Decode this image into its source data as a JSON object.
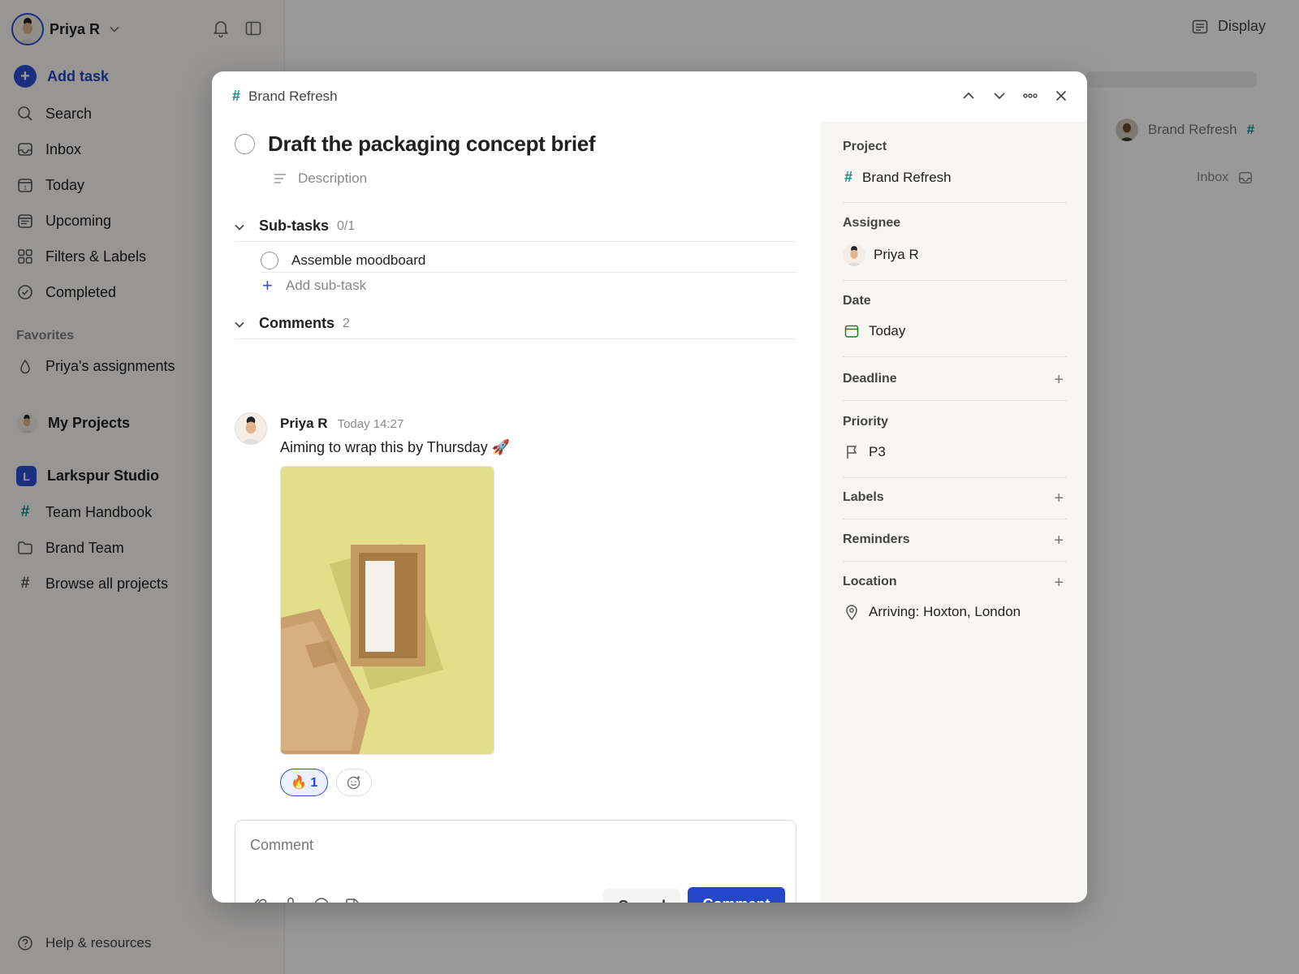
{
  "sidebar": {
    "user_name": "Priya R",
    "add_task": "Add task",
    "nav": [
      {
        "label": "Search",
        "icon": "search-icon"
      },
      {
        "label": "Inbox",
        "icon": "inbox-icon"
      },
      {
        "label": "Today",
        "icon": "calendar-today-icon"
      },
      {
        "label": "Upcoming",
        "icon": "calendar-upcoming-icon"
      },
      {
        "label": "Filters & Labels",
        "icon": "grid-icon"
      },
      {
        "label": "Completed",
        "icon": "check-circle-icon"
      }
    ],
    "favorites_title": "Favorites",
    "favorite_item": "Priya's assignments",
    "my_projects": "My Projects",
    "team": {
      "badge": "L",
      "name": "Larkspur Studio"
    },
    "team_items": [
      {
        "label": "Team Handbook",
        "icon": "hash-icon"
      },
      {
        "label": "Brand Team",
        "icon": "folder-icon"
      },
      {
        "label": "Browse all projects",
        "icon": "hash-icon"
      }
    ],
    "help": "Help & resources"
  },
  "background": {
    "display": "Display",
    "project": "Brand Refresh",
    "project_hash": "#",
    "inbox": "Inbox"
  },
  "modal": {
    "breadcrumb_hash": "#",
    "breadcrumb": "Brand Refresh",
    "title": "Draft the packaging concept brief",
    "description_placeholder": "Description",
    "subtasks": {
      "title": "Sub-tasks",
      "count": "0/1",
      "items": [
        "Assemble moodboard"
      ],
      "add_label": "Add sub-task"
    },
    "comments": {
      "title": "Comments",
      "count": "2"
    },
    "comment": {
      "author": "Priya R",
      "time": "Today 14:27",
      "text": "Aiming to wrap this by Thursday 🚀",
      "reaction": "🔥 1"
    },
    "composer": {
      "placeholder": "Comment",
      "cancel": "Cancel",
      "submit": "Comment"
    },
    "details": {
      "project_label": "Project",
      "project_hash": "#",
      "project_value": "Brand Refresh",
      "assignee_label": "Assignee",
      "assignee_value": "Priya R",
      "date_label": "Date",
      "date_value": "Today",
      "deadline_label": "Deadline",
      "priority_label": "Priority",
      "priority_value": "P3",
      "labels_label": "Labels",
      "reminders_label": "Reminders",
      "location_label": "Location",
      "location_value": "Arriving: Hoxton, London"
    }
  },
  "colors": {
    "accent": "#2446c8",
    "project_hash": "#11908a",
    "panel_bg": "#f8f6f2"
  }
}
